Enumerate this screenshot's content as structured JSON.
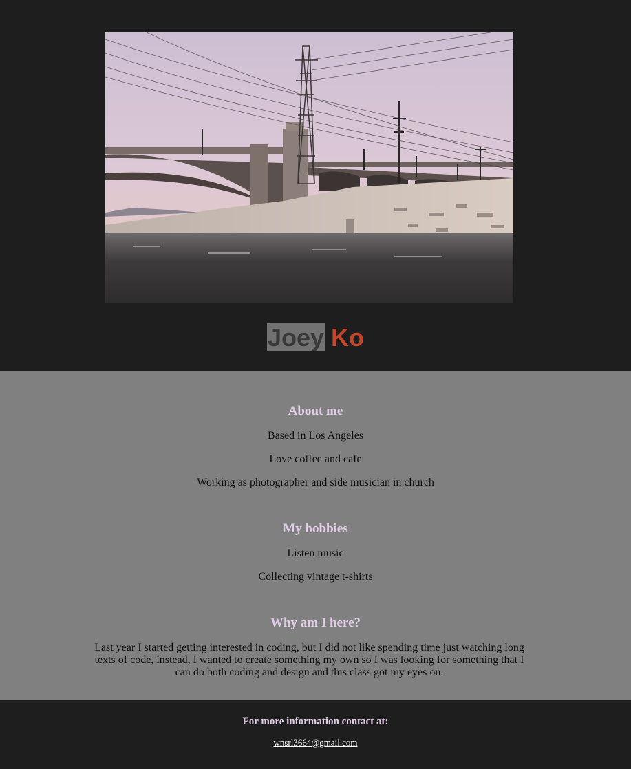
{
  "header": {
    "name_first": "Joey",
    "name_last": "Ko",
    "hero_image": "bridge-photo"
  },
  "about": {
    "heading": "About me",
    "items": [
      "Based in Los Angeles",
      "Love coffee and cafe",
      "Working as photographer and side musician in church"
    ]
  },
  "hobbies": {
    "heading": "My hobbies",
    "items": [
      "Listen music",
      "Collecting vintage t-shirts"
    ]
  },
  "why": {
    "heading": "Why am I here?",
    "text": "Last year I started getting interested in coding, but I did not like spending time just watching long texts of code, instead, I wanted to create something my own so I was looking for something that I can do both coding and design and this class got my eyes on."
  },
  "footer": {
    "contact_label": "For more information contact at:",
    "email": "wnsrl3664@gmail.com"
  },
  "colors": {
    "dark_bg": "#1e1e1e",
    "content_bg": "#808080",
    "heading_lavender": "#e2cde8",
    "accent_rust": "#c2472b"
  }
}
